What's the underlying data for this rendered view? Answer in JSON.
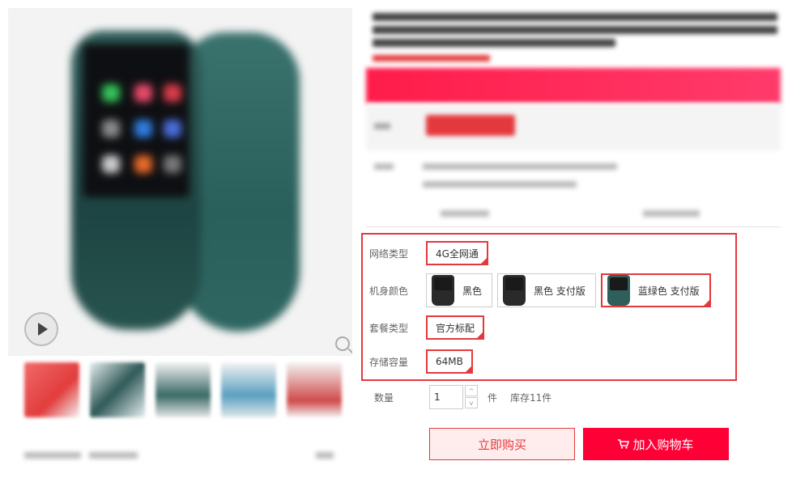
{
  "spec": {
    "network_label": "网络类型",
    "network_options": [
      "4G全网通"
    ],
    "color_label": "机身颜色",
    "color_options": [
      "黑色",
      "黑色 支付版",
      "蓝绿色 支付版"
    ],
    "package_label": "套餐类型",
    "package_options": [
      "官方标配"
    ],
    "storage_label": "存储容量",
    "storage_options": [
      "64MB"
    ]
  },
  "quantity": {
    "label": "数量",
    "value": "1",
    "unit": "件",
    "stock": "库存11件",
    "up": "^",
    "down": "v"
  },
  "actions": {
    "buy_now": "立即购买",
    "add_to_cart": "加入购物车"
  },
  "colors": {
    "accent": "#e4393c",
    "cart_button": "#ff0036",
    "buy_now_bg": "#ffeded"
  }
}
